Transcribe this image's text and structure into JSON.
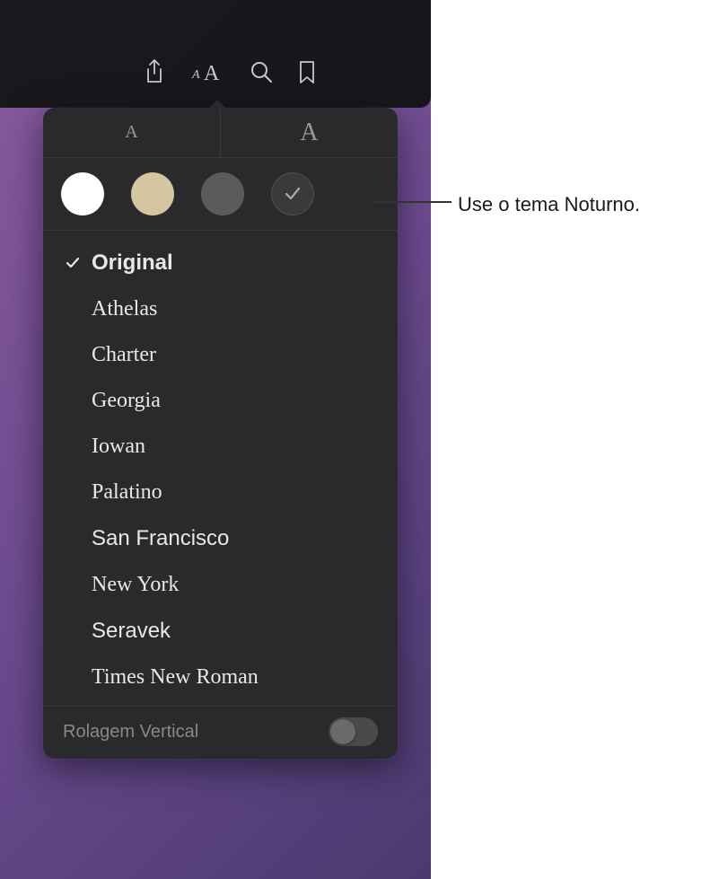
{
  "toolbar": {
    "share_icon": "share",
    "appearance_icon": "appearance",
    "search_icon": "search",
    "bookmark_icon": "bookmark"
  },
  "size_controls": {
    "small_label": "A",
    "large_label": "A"
  },
  "themes": {
    "selected": "night"
  },
  "fonts": {
    "selected_index": 0,
    "items": [
      {
        "name": "Original",
        "css": "font-original"
      },
      {
        "name": "Athelas",
        "css": "font-athelas"
      },
      {
        "name": "Charter",
        "css": "font-charter"
      },
      {
        "name": "Georgia",
        "css": "font-georgia"
      },
      {
        "name": "Iowan",
        "css": "font-iowan"
      },
      {
        "name": "Palatino",
        "css": "font-palatino"
      },
      {
        "name": "San Francisco",
        "css": "font-sanfrancisco"
      },
      {
        "name": "New York",
        "css": "font-newyork"
      },
      {
        "name": "Seravek",
        "css": "font-seravek"
      },
      {
        "name": "Times New Roman",
        "css": "font-times"
      }
    ]
  },
  "scroll": {
    "label": "Rolagem Vertical",
    "enabled": false
  },
  "callout": {
    "text": "Use o tema Noturno."
  }
}
